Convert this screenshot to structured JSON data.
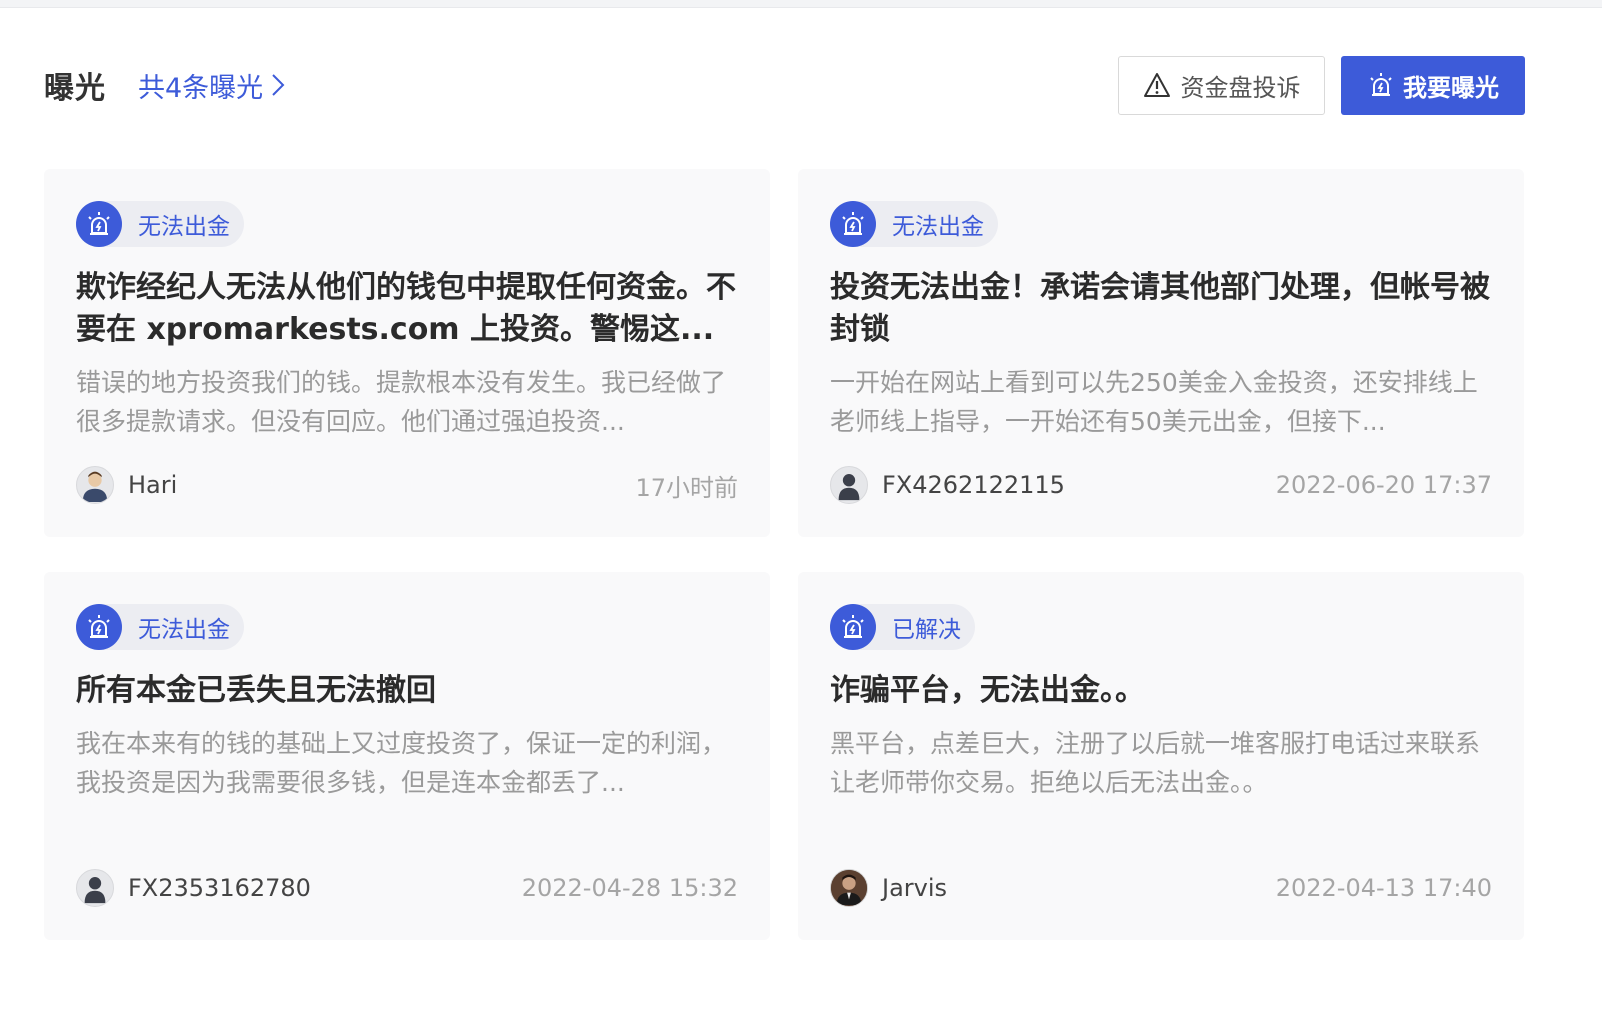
{
  "colors": {
    "accent": "#3d5bd9",
    "card_bg": "#f9f9fa",
    "muted_text": "#9a9a9a"
  },
  "header": {
    "title": "曝光",
    "count_link": "共4条曝光",
    "complain_button": "资金盘投诉",
    "expose_button": "我要曝光"
  },
  "cards": [
    {
      "tag": "无法出金",
      "tag_icon": "alarm-siren-icon",
      "title": "欺诈经纪人无法从他们的钱包中提取任何资金。不要在 xpromarkests.com 上投资。警惕这...",
      "description": "错误的地方投资我们的钱。提款根本没有发生。我已经做了很多提款请求。但没有回应。他们通过强迫投资...",
      "user": "Hari",
      "avatar": "user-avatar-illustration",
      "time": "17小时前"
    },
    {
      "tag": "无法出金",
      "tag_icon": "alarm-siren-icon",
      "title": "投资无法出金！承诺会请其他部门处理，但帐号被封锁",
      "description": "一开始在网站上看到可以先250美金入金投资，还安排线上老师线上指导，一开始还有50美元出金，但接下...",
      "user": "FX4262122115",
      "avatar": "default-user-avatar",
      "time": "2022-06-20 17:37"
    },
    {
      "tag": "无法出金",
      "tag_icon": "alarm-siren-icon",
      "title": "所有本金已丢失且无法撤回",
      "description": "我在本来有的钱的基础上又过度投资了，保证一定的利润，我投资是因为我需要很多钱，但是连本金都丢了...",
      "user": "FX2353162780",
      "avatar": "default-user-avatar",
      "time": "2022-04-28 15:32"
    },
    {
      "tag": "已解决",
      "tag_icon": "alarm-siren-icon",
      "title": "诈骗平台，无法出金。。",
      "description": "黑平台，点差巨大，注册了以后就一堆客服打电话过来联系让老师带你交易。拒绝以后无法出金。。",
      "user": "Jarvis",
      "avatar": "photo-avatar",
      "time": "2022-04-13 17:40"
    }
  ]
}
